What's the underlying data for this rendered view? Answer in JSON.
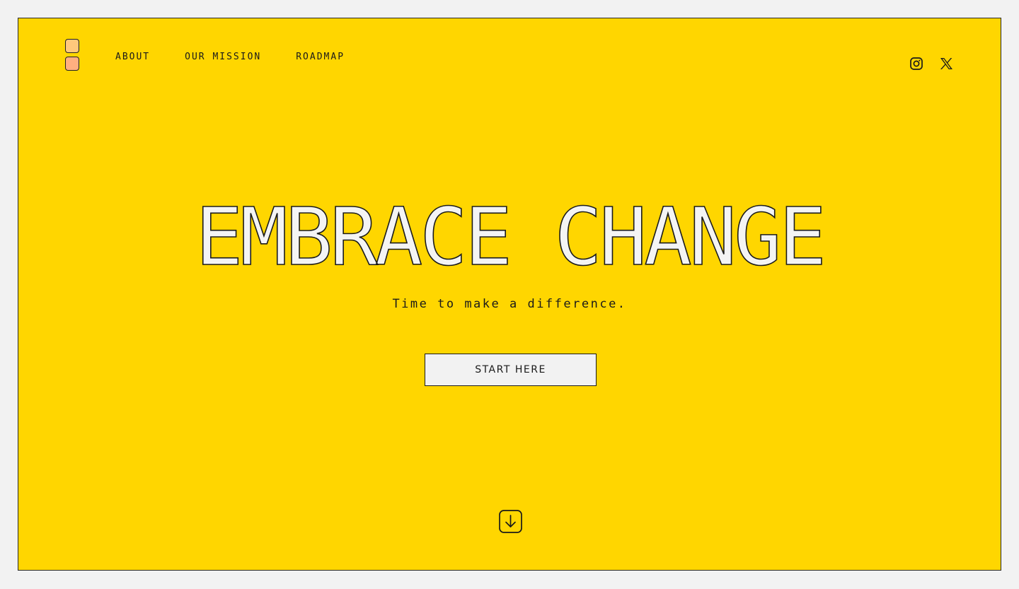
{
  "nav": {
    "items": [
      {
        "label": "ABOUT"
      },
      {
        "label": "OUR MISSION"
      },
      {
        "label": "ROADMAP"
      }
    ]
  },
  "social": {
    "icons": [
      "instagram-icon",
      "x-icon"
    ]
  },
  "hero": {
    "headline": "EMBRACE CHANGE",
    "subtitle": "Time to make a difference.",
    "cta_label": "START HERE"
  },
  "icons": {
    "scroll": "arrow-down-icon"
  },
  "colors": {
    "background": "#FFD600",
    "page": "#f2f2f2",
    "ink": "#1a1a1a",
    "logo_top": "#FFC87C",
    "logo_bottom": "#FFAF80"
  }
}
